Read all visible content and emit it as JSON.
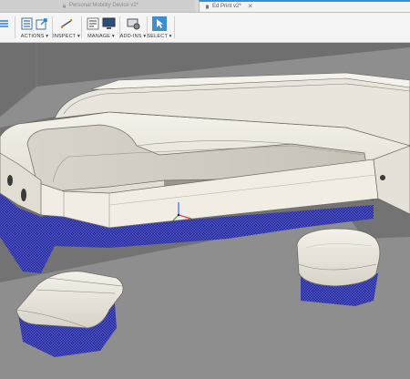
{
  "tabs": [
    {
      "label": "Personal Mobility Device v2*",
      "state": "inactive"
    },
    {
      "label": "Ed Print v2*",
      "state": "active"
    }
  ],
  "toolbar": {
    "groups": [
      {
        "label": "ACTIONS ▾",
        "icons": [
          "list-icon",
          "document-icon",
          "export-icon"
        ]
      },
      {
        "label": "INSPECT ▾",
        "icons": [
          "measure-icon"
        ]
      },
      {
        "label": "MANAGE ▾",
        "icons": [
          "list-settings-icon",
          "monitor-icon"
        ]
      },
      {
        "label": "ADD-INS ▾",
        "icons": [
          "gear-monitor-icon"
        ]
      },
      {
        "label": "SELECT ▾",
        "icons": [
          "cursor-select-icon"
        ]
      }
    ]
  },
  "colors": {
    "background": "#6f6f6f",
    "floor": "#8e8e8e",
    "part": "#ece8df",
    "support": "#2b2f9e",
    "accent": "#3a8fd6"
  }
}
